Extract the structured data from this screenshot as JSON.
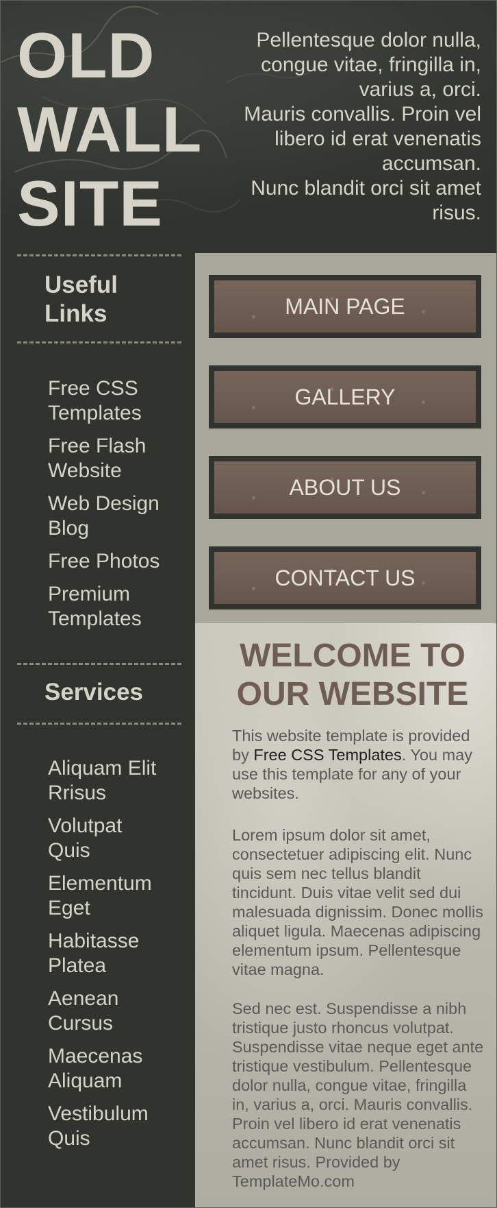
{
  "header": {
    "title_lines": [
      "OLD",
      "WALL",
      "SITE"
    ],
    "text_lines": [
      "Pellentesque dolor nulla,",
      "congue vitae, fringilla in,",
      "varius a, orci.",
      "Mauris convallis. Proin vel",
      "libero id erat venenatis",
      "accumsan.",
      "Nunc blandit orci sit amet",
      "risus."
    ]
  },
  "sidebar": {
    "useful_links": {
      "heading_lines": [
        "Useful",
        "Links"
      ],
      "items": [
        {
          "line1": "Free CSS",
          "line2": "Templates"
        },
        {
          "line1": "Free Flash",
          "line2": "Website"
        },
        {
          "line1": "Web Design",
          "line2": "Blog"
        },
        {
          "line1": "Free Photos",
          "line2": ""
        },
        {
          "line1": "Premium",
          "line2": "Templates"
        }
      ]
    },
    "services": {
      "heading": "Services",
      "items": [
        {
          "line1": "Aliquam Elit",
          "line2": "Rrisus"
        },
        {
          "line1": "Volutpat",
          "line2": "Quis"
        },
        {
          "line1": "Elementum",
          "line2": "Eget"
        },
        {
          "line1": "Habitasse",
          "line2": "Platea"
        },
        {
          "line1": "Aenean",
          "line2": "Cursus"
        },
        {
          "line1": "Maecenas",
          "line2": "Aliquam"
        },
        {
          "line1": "Vestibulum",
          "line2": "Quis"
        }
      ]
    }
  },
  "nav": {
    "items": [
      "MAIN PAGE",
      "GALLERY",
      "ABOUT US",
      "CONTACT US"
    ]
  },
  "content": {
    "welcome_lines": [
      "WELCOME TO",
      "OUR WEBSITE"
    ],
    "intro": {
      "before": "This website template is provided by ",
      "link": "Free CSS Templates",
      "after": ". You may use this template for any of your websites."
    },
    "paragraph2": "Lorem ipsum dolor sit amet, consectetuer adipiscing elit. Nunc quis sem nec tellus blandit tincidunt. Duis vitae velit sed dui malesuada dignissim. Donec mollis aliquet ligula. Maecenas adipiscing elementum ipsum. Pellentesque vitae magna.",
    "paragraph3": "Sed nec est. Suspendisse a nibh tristique justo rhoncus volutpat. Suspendisse vitae neque eget ante tristique vestibulum. Pellentesque dolor nulla, congue vitae, fringilla in, varius a, orci. Mauris convallis. Proin vel libero id erat venenatis accumsan. Nunc blandit orci sit amet risus. Provided by TemplateMo.com"
  },
  "colors": {
    "dark_bg": "#30332e",
    "light_text": "#d6d4c8",
    "nav_bg": "#a8a79b",
    "button_brown": "#6e5d53",
    "heading_brown": "#6e5d53"
  }
}
